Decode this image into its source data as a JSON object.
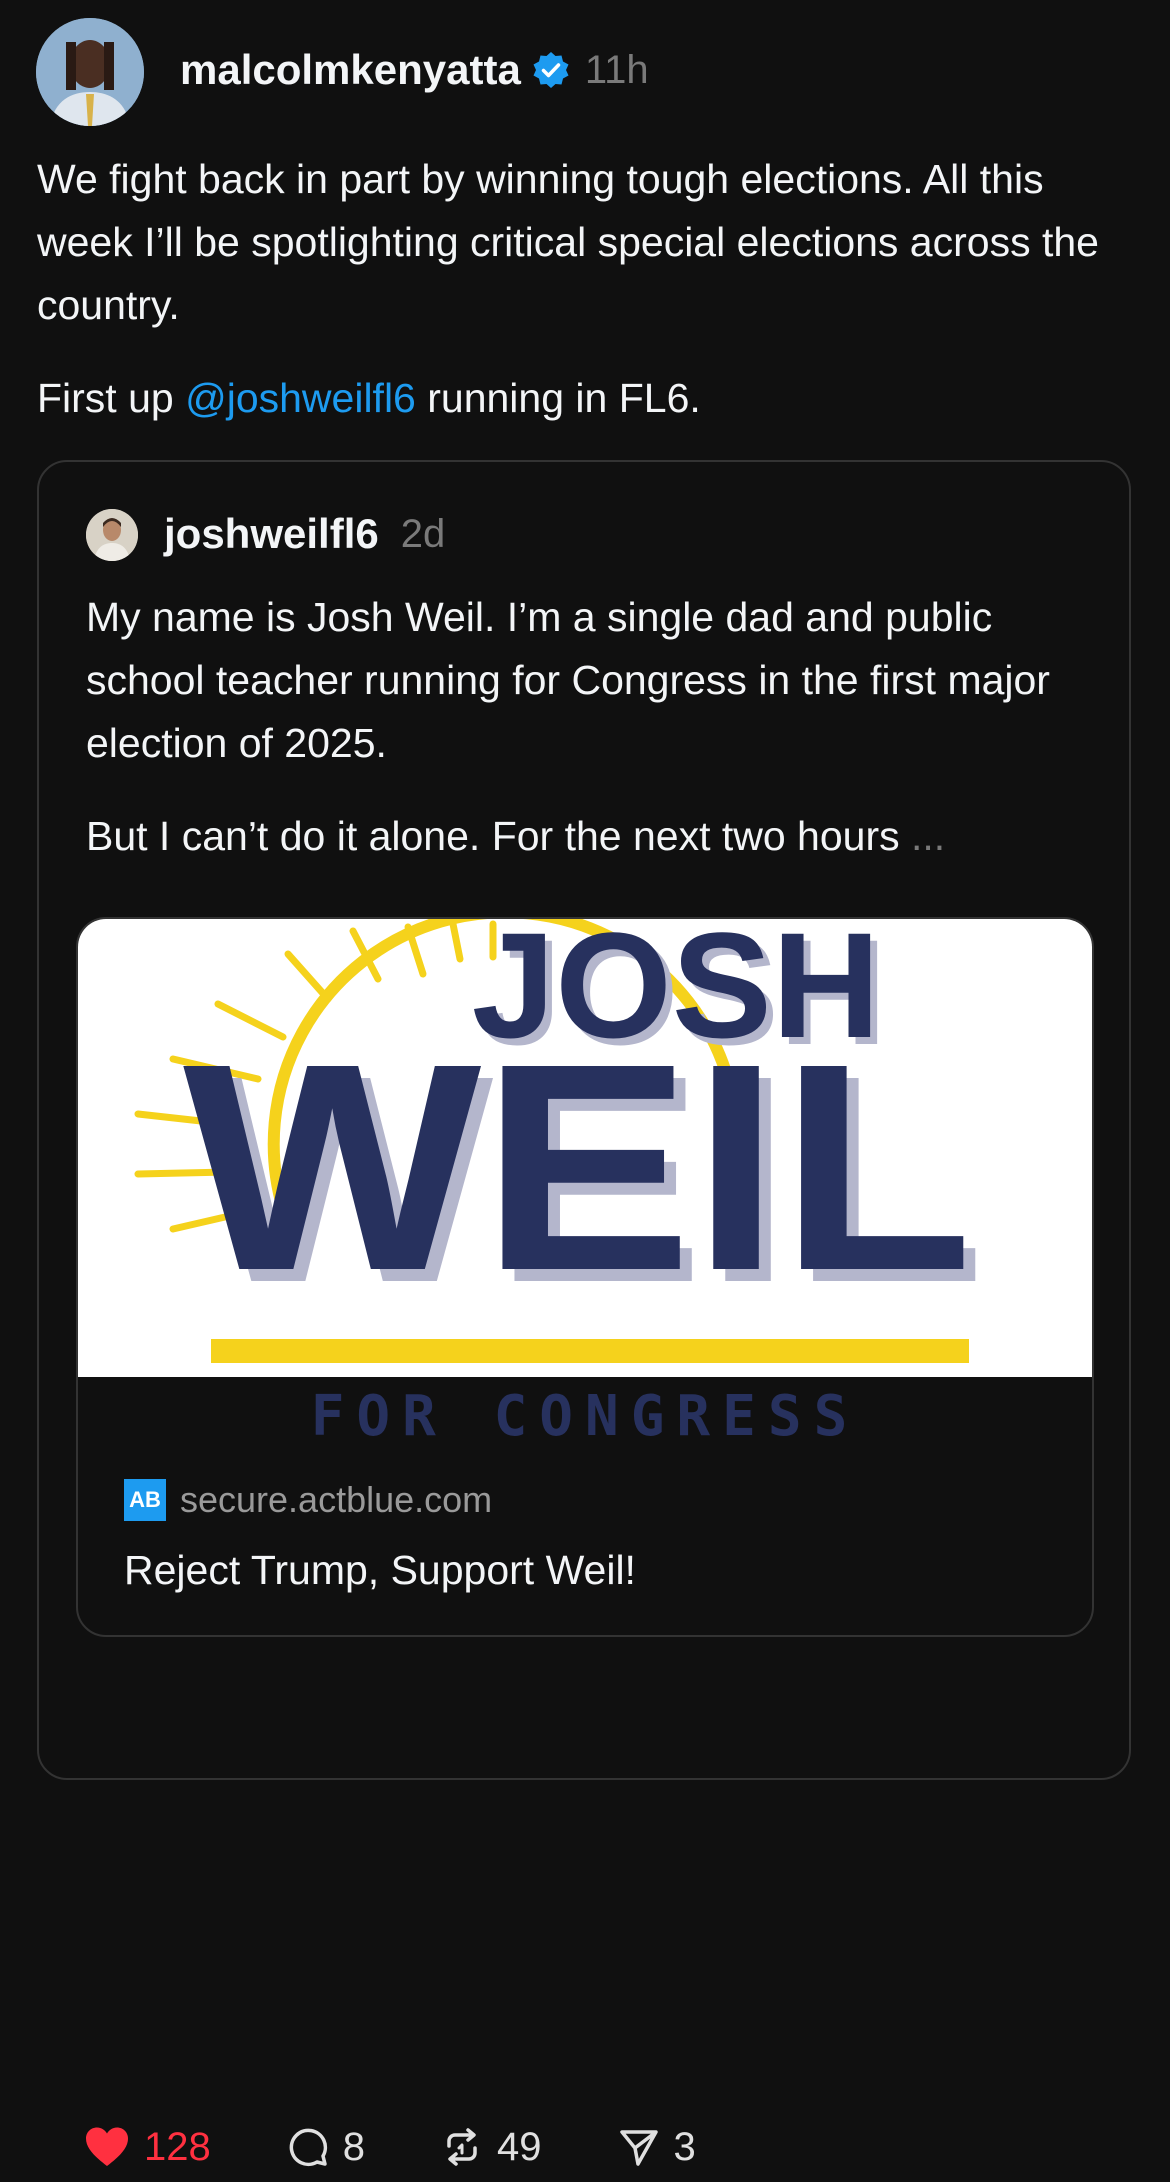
{
  "post": {
    "username": "malcolmkenyatta",
    "time": "11h",
    "text_p1": "We fight back in part by winning tough elections. All this week I’ll be spotlighting critical special elections across the country.",
    "text_p2_before": "First up ",
    "mention": "@joshweilfl6",
    "text_p2_after": " running in FL6."
  },
  "quote": {
    "username": "joshweilfl6",
    "time": "2d",
    "text_p1": "My name is Josh Weil. I’m a single dad and public school teacher running for Congress in the first major election of 2025.",
    "text_p2": "But I can’t do it alone. For the next two hours ",
    "ellipsis": "...",
    "link": {
      "logo_line1": "JOSH",
      "logo_line2": "WEIL",
      "logo_subtitle": "FOR CONGRESS",
      "domain_icon": "AB",
      "domain": "secure.actblue.com",
      "title": "Reject Trump, Support Weil!"
    }
  },
  "actions": {
    "likes": "128",
    "comments": "8",
    "reposts": "49",
    "shares": "3"
  },
  "colors": {
    "background": "#101010",
    "mention": "#1d9bf0",
    "like": "#ff3040",
    "logo_navy": "#27315e",
    "logo_yellow": "#f5d21c"
  },
  "icons": [
    "verified-badge-icon",
    "heart-icon",
    "comment-icon",
    "repost-icon",
    "share-icon",
    "actblue-icon"
  ]
}
